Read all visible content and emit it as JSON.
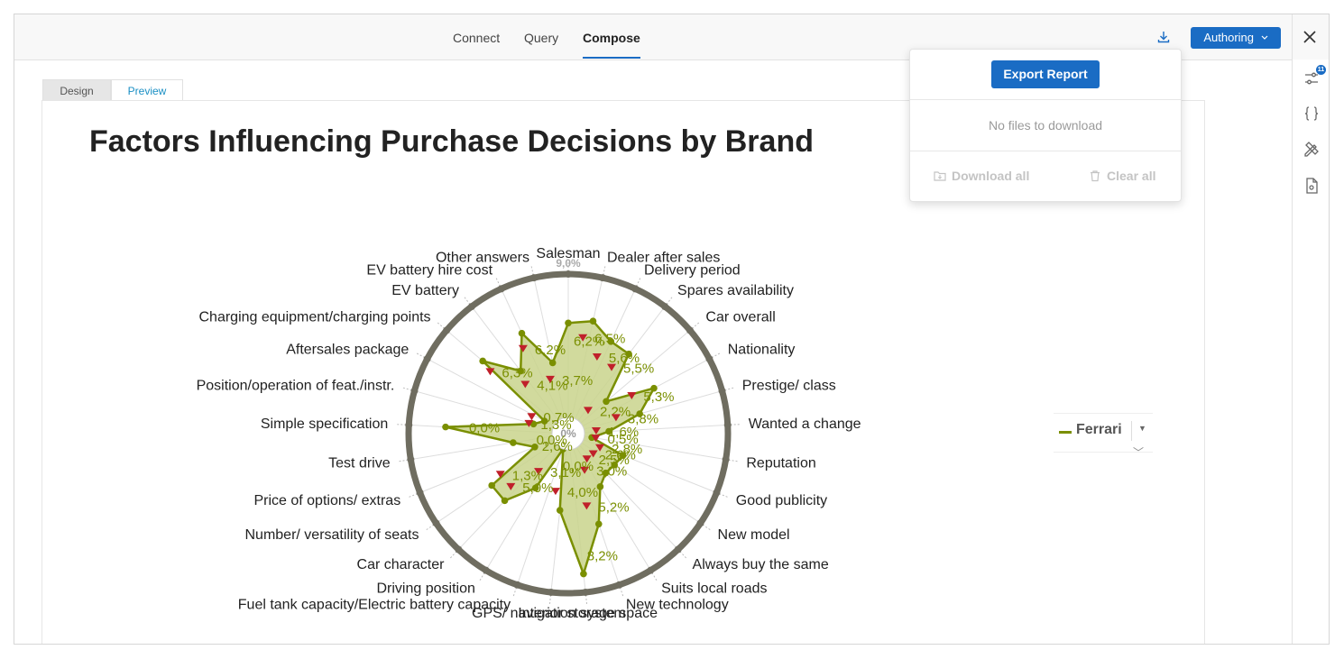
{
  "nav": {
    "tabs": [
      {
        "label": "Connect"
      },
      {
        "label": "Query"
      },
      {
        "label": "Compose"
      }
    ],
    "authoring_label": "Authoring"
  },
  "rail": {
    "badge": "11"
  },
  "editor": {
    "design_tab": "Design",
    "preview_tab": "Preview"
  },
  "report": {
    "title": "Factors Influencing Purchase Decisions by Brand"
  },
  "legend": {
    "series_name": "Ferrari"
  },
  "popover": {
    "export_label": "Export Report",
    "empty_text": "No files to download",
    "download_all_label": "Download all",
    "clear_all_label": "Clear all"
  },
  "colors": {
    "accent": "#1a6cc4",
    "series": "#7a8f00",
    "series_fill": "#c9d48c",
    "down_marker": "#c0202a",
    "ring": "#6f6d60"
  },
  "chart_data": {
    "type": "radar",
    "axis_max_label": "9,0%",
    "center_label": "0%",
    "rmax": 9.0,
    "series": [
      {
        "name": "Ferrari"
      }
    ],
    "categories": [
      "Salesman",
      "Dealer after sales",
      "Delivery period",
      "Spares availability",
      "Car overall",
      "Nationality",
      "Prestige/ class",
      "Wanted a change",
      "Reputation",
      "Good publicity",
      "New model",
      "Always buy the same",
      "Suits local roads",
      "New technology",
      "Interior storage space",
      "GPS/ navigation system",
      "Fuel tank capacity/Electric battery capacity",
      "Driving position",
      "Car character",
      "Number/ versatility of seats",
      "Price of options/ extras",
      "Test drive",
      "Simple specification",
      "Position/operation of feat./instr.",
      "Aftersales package",
      "Charging equipment/charging points",
      "EV battery",
      "EV battery hire cost",
      "Other answers"
    ],
    "values": [
      6.2,
      6.5,
      5.6,
      5.5,
      2.2,
      5.3,
      3.8,
      1.6,
      0.5,
      2.8,
      2.6,
      2.5,
      3.0,
      5.2,
      8.2,
      4.0,
      0.0,
      3.1,
      5.0,
      5.0,
      1.3,
      2.6,
      7.0,
      1.3,
      0.7,
      6.3,
      4.1,
      6.2,
      3.7
    ],
    "labels": [
      "6,2%",
      "6,5%",
      "5,6%",
      "5,5%",
      "2,2%",
      "5,3%",
      "3,8%",
      "1,6%",
      "0,5%",
      "2,8%",
      "2,6%",
      "2,5%",
      "3,0%",
      "5,2%",
      "8,2%",
      "4,0%",
      "0,0%",
      "3,1%",
      "5,0%",
      "1,3%",
      "2,6%",
      "0,0%",
      "0,0%",
      "1,3%",
      "0,7%",
      "6,3%",
      "4,1%",
      "6,2%",
      "3,7%"
    ],
    "down_marker": [
      false,
      true,
      true,
      true,
      true,
      true,
      true,
      true,
      true,
      true,
      true,
      true,
      true,
      true,
      false,
      true,
      false,
      true,
      true,
      true,
      false,
      false,
      false,
      true,
      true,
      true,
      true,
      true,
      true
    ]
  }
}
